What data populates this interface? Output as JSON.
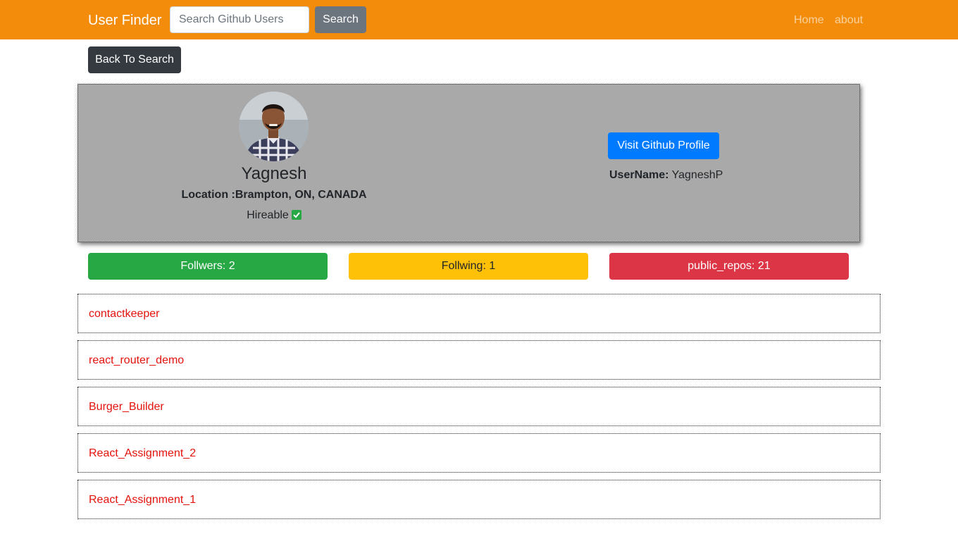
{
  "navbar": {
    "brand": "User Finder",
    "search_placeholder": "Search Github Users",
    "search_button": "Search",
    "links": [
      "Home",
      "about"
    ]
  },
  "back_button": "Back To Search",
  "profile": {
    "name": "Yagnesh",
    "location_label": "Location :",
    "location": "Brampton, ON, CANADA",
    "hireable_label": "Hireable",
    "hireable": true,
    "visit_button": "Visit Github Profile",
    "username_label": "UserName:",
    "username": "YagneshP"
  },
  "stats": {
    "followers": "Follwers: 2",
    "following": "Follwing: 1",
    "public_repos": "public_repos: 21"
  },
  "repos": [
    "contactkeeper",
    "react_router_demo",
    "Burger_Builder",
    "React_Assignment_2",
    "React_Assignment_1"
  ],
  "colors": {
    "navbar": "#f28c0a",
    "card": "#a9a9a9",
    "followers": "#28a745",
    "following": "#ffc107",
    "repos": "#dc3545",
    "visit_button": "#007bff",
    "repo_link": "#e3120b"
  }
}
